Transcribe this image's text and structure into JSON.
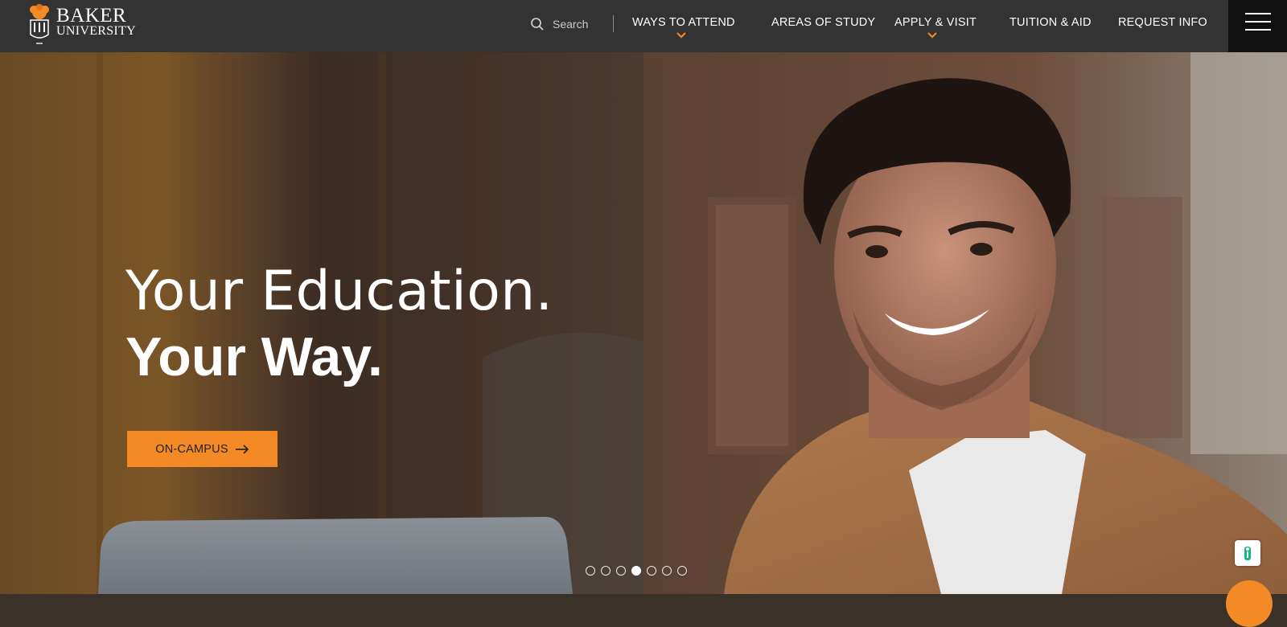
{
  "brand": {
    "name_line1": "BAKER",
    "name_line2": "UNIVERSITY",
    "accent_color": "#f38a25",
    "header_color": "#333333"
  },
  "header": {
    "search_placeholder": "Search",
    "nav": [
      {
        "label": "WAYS TO ATTEND",
        "has_dropdown": true
      },
      {
        "label": "AREAS OF STUDY",
        "has_dropdown": false
      },
      {
        "label": "APPLY & VISIT",
        "has_dropdown": true
      },
      {
        "label": "TUITION & AID",
        "has_dropdown": false
      },
      {
        "label": "REQUEST INFO",
        "has_dropdown": false
      }
    ],
    "menu_icon": "hamburger-icon"
  },
  "hero": {
    "headline_light": "Your Education.",
    "headline_bold": "Your Way.",
    "cta_label": "ON-CAMPUS",
    "cta_icon": "arrow-right-icon",
    "slides_total": 7,
    "active_slide": 4
  },
  "widgets": {
    "accessibility_icon": "accessibility-icon",
    "chat_icon": "chat-icon"
  }
}
